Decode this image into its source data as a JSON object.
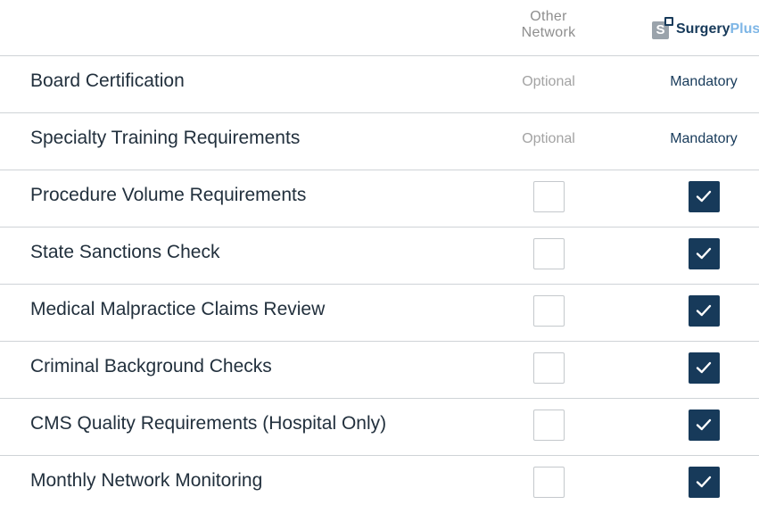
{
  "header": {
    "other_network_line1": "Other",
    "other_network_line2": "Network",
    "brand_mark_letter": "S",
    "brand_name": "Surgery",
    "brand_suffix": "Plus"
  },
  "colors": {
    "brand_navy": "#173a5a",
    "brand_light_blue": "#7eb6e6",
    "muted_gray": "#a3a3a3",
    "divider": "#cfd3d7"
  },
  "rows": [
    {
      "label": "Board Certification",
      "other": "Optional",
      "surgery": "Mandatory"
    },
    {
      "label": "Specialty Training Requirements",
      "other": "Optional",
      "surgery": "Mandatory"
    },
    {
      "label": "Procedure Volume Requirements",
      "other_checked": false,
      "surgery_checked": true
    },
    {
      "label": "State Sanctions Check",
      "other_checked": false,
      "surgery_checked": true
    },
    {
      "label": "Medical Malpractice Claims Review",
      "other_checked": false,
      "surgery_checked": true
    },
    {
      "label": "Criminal Background Checks",
      "other_checked": false,
      "surgery_checked": true
    },
    {
      "label": "CMS Quality Requirements (Hospital Only)",
      "other_checked": false,
      "surgery_checked": true
    },
    {
      "label": "Monthly Network Monitoring",
      "other_checked": false,
      "surgery_checked": true
    }
  ],
  "icons": {
    "checkmark": "check-icon",
    "brand_logo": "surgeryplus-logo-icon"
  }
}
